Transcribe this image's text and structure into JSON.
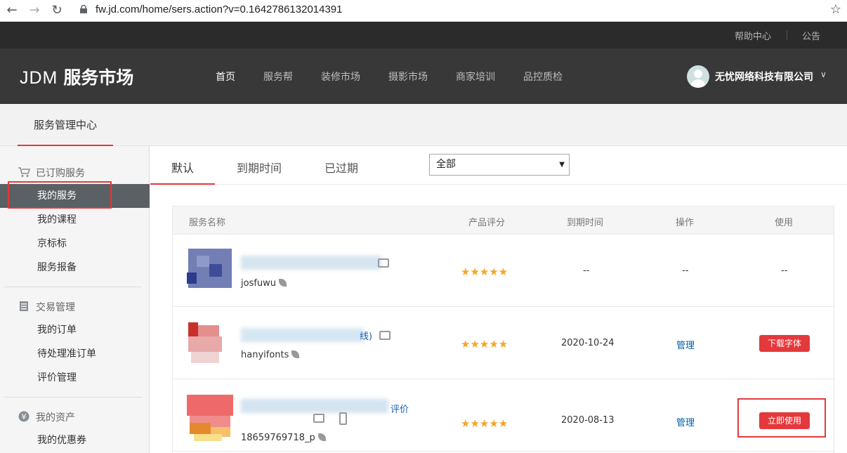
{
  "browser": {
    "url": "fw.jd.com/home/sers.action?v=0.1642786132014391"
  },
  "util_links": [
    "帮助中心",
    "公告"
  ],
  "header": {
    "logo_prefix": "JDM",
    "logo_text": "服务市场",
    "nav": [
      "首页",
      "服务帮",
      "装修市场",
      "摄影市场",
      "商家培训",
      "品控质检"
    ],
    "company": "无忧网络科技有限公司"
  },
  "subheader": {
    "title": "服务管理中心"
  },
  "sidebar": {
    "sections": [
      {
        "title": "已订购服务",
        "icon": "cart-icon",
        "items": [
          "我的服务",
          "我的课程",
          "京标标",
          "服务报备"
        ]
      },
      {
        "title": "交易管理",
        "icon": "clipboard-icon",
        "items": [
          "我的订单",
          "待处理准订单",
          "评价管理"
        ]
      },
      {
        "title": "我的资产",
        "icon": "yen-icon",
        "items": [
          "我的优惠券"
        ]
      }
    ],
    "active_item": "我的服务"
  },
  "tabs": [
    "默认",
    "到期时间",
    "已过期"
  ],
  "filter": {
    "selected": "全部"
  },
  "table": {
    "headers": [
      "服务名称",
      "产品评分",
      "到期时间",
      "操作",
      "使用"
    ],
    "rows": [
      {
        "vendor": "josfuwu",
        "rating": "★★★★★",
        "expiry": "--",
        "operation": "--",
        "use": "--"
      },
      {
        "vendor": "hanyifonts",
        "rating": "★★★★★",
        "expiry": "2020-10-24",
        "operation": "管理",
        "use": "下载字体",
        "name_fragment": "线)"
      },
      {
        "vendor": "18659769718_p",
        "rating": "★★★★★",
        "expiry": "2020-08-13",
        "operation": "管理",
        "use": "立即使用",
        "name_fragment": "评价"
      }
    ]
  },
  "colors": {
    "accent": "#e4393c",
    "header_bg": "#383838",
    "star": "#f5a623",
    "link": "#005ea7"
  }
}
